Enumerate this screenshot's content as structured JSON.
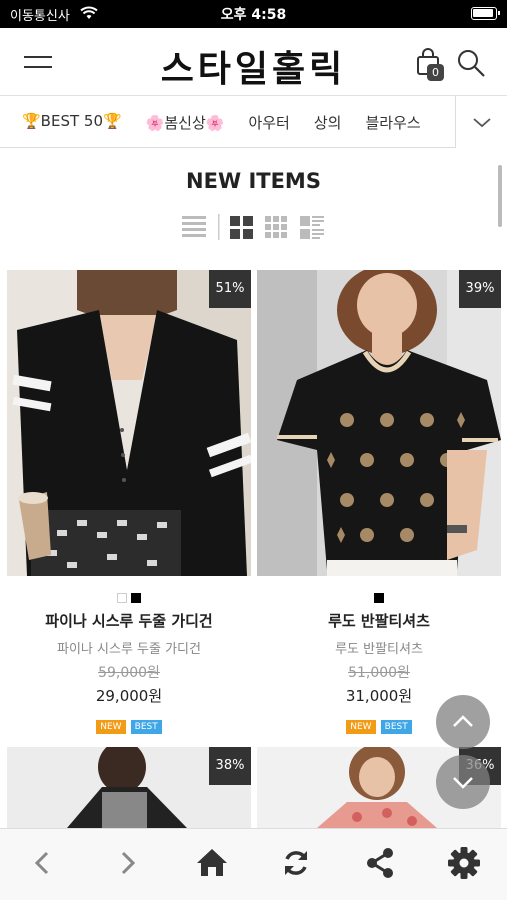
{
  "status_bar": {
    "carrier": "이동통신사",
    "time": "오후 4:58"
  },
  "header": {
    "logo": "스타일홀릭",
    "cart_count": "0"
  },
  "categories": [
    "🏆BEST 50🏆",
    "🌸봄신상🌸",
    "아우터",
    "상의",
    "블라우스"
  ],
  "section": {
    "title": "NEW ITEMS"
  },
  "products": [
    {
      "name": "파이나 시스루 두줄 가디건",
      "subtitle": "파이나 시스루 두줄 가디건",
      "original_price": "59,000원",
      "price": "29,000원",
      "discount": "51%",
      "badges": [
        "NEW",
        "BEST"
      ]
    },
    {
      "name": "루도 반팔티셔츠",
      "subtitle": "루도 반팔티셔츠",
      "original_price": "51,000원",
      "price": "31,000원",
      "discount": "39%",
      "badges": [
        "NEW",
        "BEST"
      ]
    },
    {
      "discount": "38%"
    },
    {
      "discount": "36%"
    }
  ],
  "colors": {
    "badge_new": "#f29b16",
    "badge_best": "#3fa7e8",
    "discount_bg": "#333333"
  }
}
